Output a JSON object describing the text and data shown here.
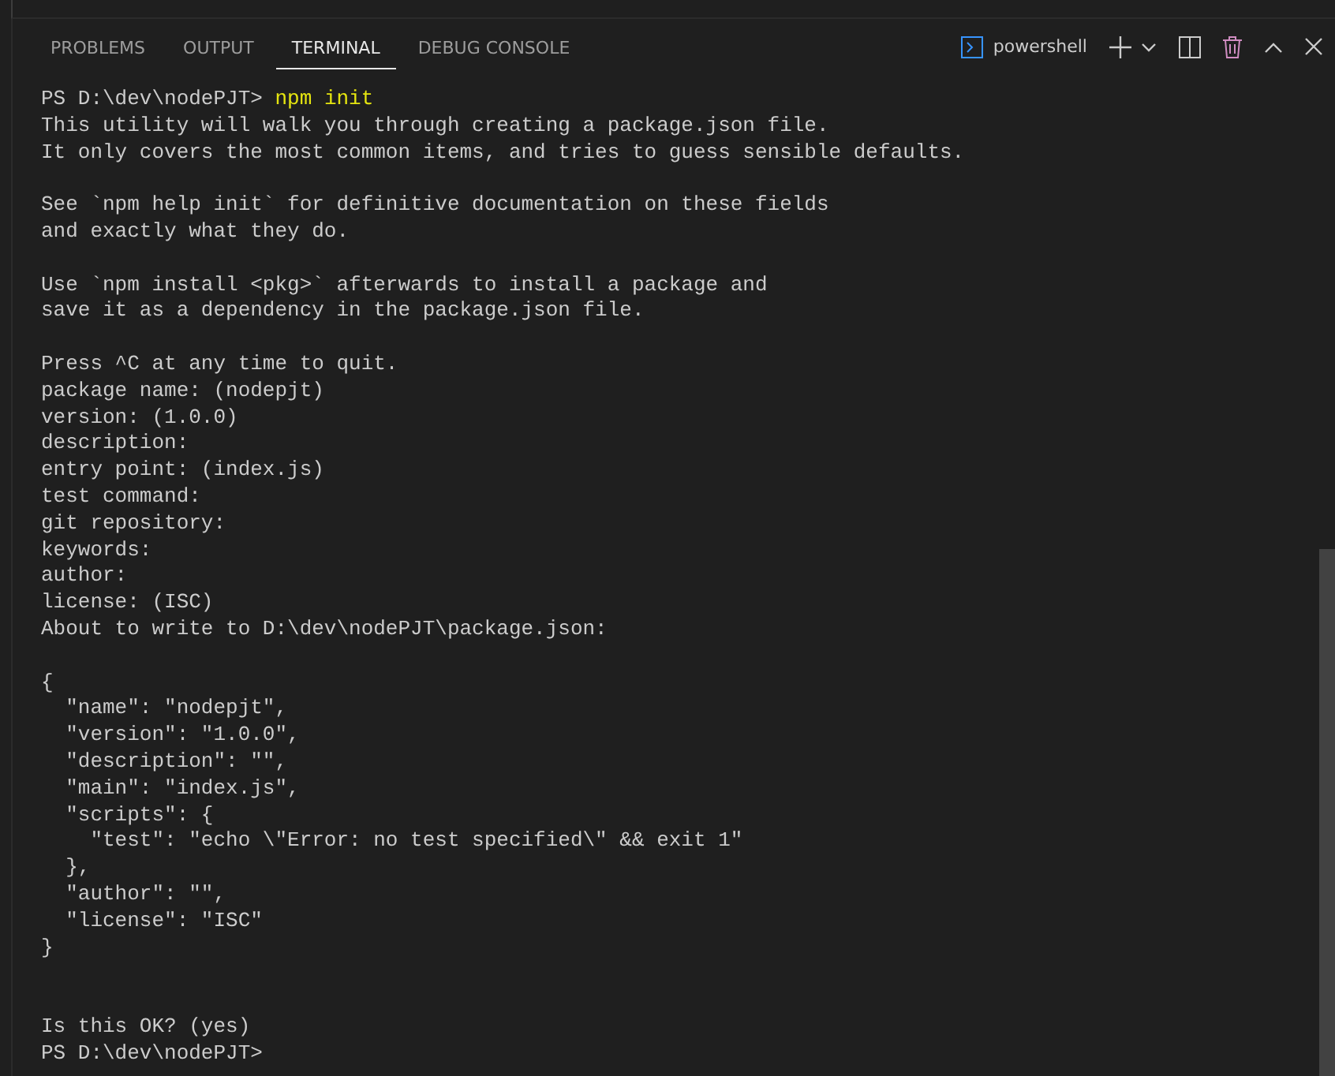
{
  "panel": {
    "tabs": [
      {
        "label": "PROBLEMS",
        "selected": false
      },
      {
        "label": "OUTPUT",
        "selected": false
      },
      {
        "label": "TERMINAL",
        "selected": true
      },
      {
        "label": "DEBUG CONSOLE",
        "selected": false
      }
    ],
    "terminal_name": "powershell"
  },
  "terminal": {
    "lines": [
      {
        "kind": "prompt",
        "prompt": "PS D:\\dev\\nodePJT>",
        "command": "npm init"
      },
      {
        "kind": "text",
        "text": "This utility will walk you through creating a package.json file."
      },
      {
        "kind": "text",
        "text": "It only covers the most common items, and tries to guess sensible defaults."
      },
      {
        "kind": "blank"
      },
      {
        "kind": "text",
        "text": "See `npm help init` for definitive documentation on these fields"
      },
      {
        "kind": "text",
        "text": "and exactly what they do."
      },
      {
        "kind": "blank"
      },
      {
        "kind": "text",
        "text": "Use `npm install <pkg>` afterwards to install a package and"
      },
      {
        "kind": "text",
        "text": "save it as a dependency in the package.json file."
      },
      {
        "kind": "blank"
      },
      {
        "kind": "text",
        "text": "Press ^C at any time to quit."
      },
      {
        "kind": "text",
        "text": "package name: (nodepjt)"
      },
      {
        "kind": "text",
        "text": "version: (1.0.0)"
      },
      {
        "kind": "text",
        "text": "description:"
      },
      {
        "kind": "text",
        "text": "entry point: (index.js)"
      },
      {
        "kind": "text",
        "text": "test command:"
      },
      {
        "kind": "text",
        "text": "git repository:"
      },
      {
        "kind": "text",
        "text": "keywords:"
      },
      {
        "kind": "text",
        "text": "author:"
      },
      {
        "kind": "text",
        "text": "license: (ISC)"
      },
      {
        "kind": "text",
        "text": "About to write to D:\\dev\\nodePJT\\package.json:"
      },
      {
        "kind": "blank"
      },
      {
        "kind": "text",
        "text": "{"
      },
      {
        "kind": "text",
        "text": "  \"name\": \"nodepjt\","
      },
      {
        "kind": "text",
        "text": "  \"version\": \"1.0.0\","
      },
      {
        "kind": "text",
        "text": "  \"description\": \"\","
      },
      {
        "kind": "text",
        "text": "  \"main\": \"index.js\","
      },
      {
        "kind": "text",
        "text": "  \"scripts\": {"
      },
      {
        "kind": "text",
        "text": "    \"test\": \"echo \\\"Error: no test specified\\\" && exit 1\""
      },
      {
        "kind": "text",
        "text": "  },"
      },
      {
        "kind": "text",
        "text": "  \"author\": \"\","
      },
      {
        "kind": "text",
        "text": "  \"license\": \"ISC\""
      },
      {
        "kind": "text",
        "text": "}"
      },
      {
        "kind": "blank"
      },
      {
        "kind": "blank"
      },
      {
        "kind": "text",
        "text": "Is this OK? (yes)"
      },
      {
        "kind": "prompt",
        "prompt": "PS D:\\dev\\nodePJT>"
      }
    ]
  }
}
